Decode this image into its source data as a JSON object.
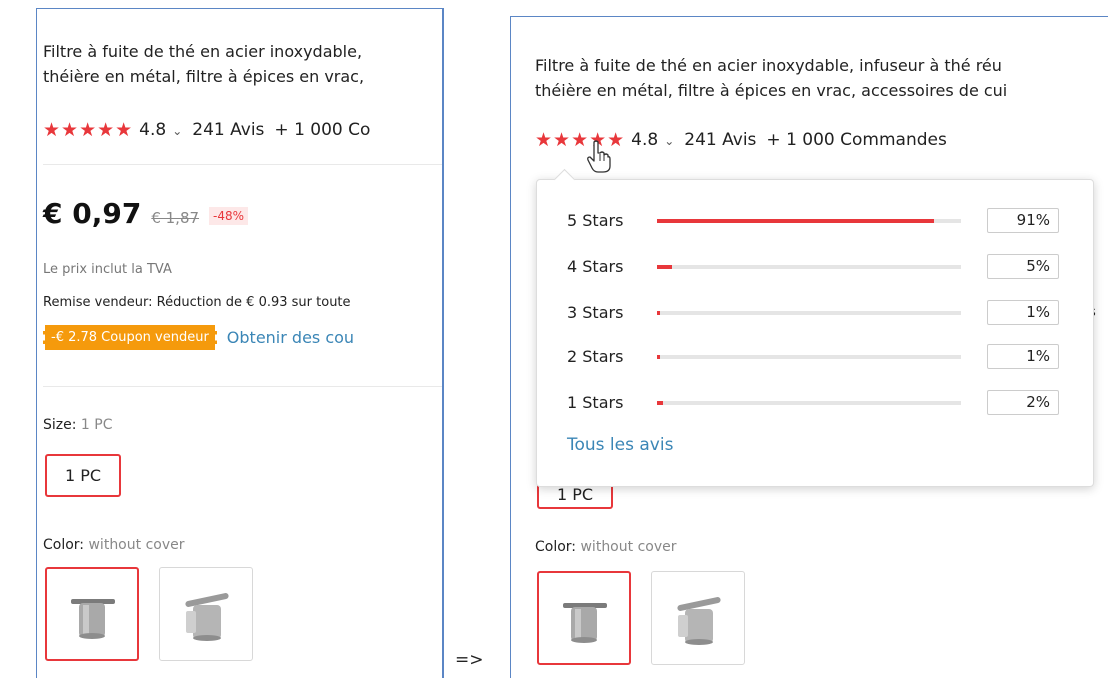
{
  "arrow": "=>",
  "left": {
    "title_line1": "Filtre à fuite de thé en acier inoxydable,",
    "title_line2": "théière en métal, filtre à épices en vrac,",
    "stars": "★★★★★",
    "rating": "4.8",
    "reviews": "241 Avis",
    "orders": "+ 1 000 Co",
    "price_now": "€ 0,97",
    "price_old": "€ 1,87",
    "discount": "-48%",
    "vat_note": "Le prix inclut la TVA",
    "seller_discount": "Remise vendeur: Réduction de € 0.93 sur toute",
    "coupon": "-€ 2.78 Coupon vendeur",
    "coupon_link": "Obtenir des cou",
    "size_label": "Size: ",
    "size_value": "1 PC",
    "size_option": "1 PC",
    "color_label": "Color: ",
    "color_value": "without cover"
  },
  "right": {
    "title_line1": "Filtre à fuite de thé en acier inoxydable, infuseur à thé réu",
    "title_line2": "théière en métal, filtre à épices en vrac, accessoires de cui",
    "stars": "★★★★★",
    "rating": "4.8",
    "reviews": "241 Avis",
    "orders": "+ 1 000 Commandes",
    "behind_fragment": "s",
    "size_option_fragment": "1 PC",
    "color_label": "Color: ",
    "color_value": "without cover"
  },
  "rating_popup": {
    "rows": [
      {
        "label": "5 Stars",
        "percent": "91%",
        "fraction": 0.91
      },
      {
        "label": "4 Stars",
        "percent": "5%",
        "fraction": 0.05
      },
      {
        "label": "3 Stars",
        "percent": "1%",
        "fraction": 0.01
      },
      {
        "label": "2 Stars",
        "percent": "1%",
        "fraction": 0.01
      },
      {
        "label": "1 Stars",
        "percent": "2%",
        "fraction": 0.02
      }
    ],
    "all_reviews": "Tous les avis"
  },
  "colors": {
    "accent_red": "#e8373b",
    "coupon_orange": "#f59a0c",
    "link_blue": "#3b86b6",
    "frame_blue": "#5b86c5"
  }
}
